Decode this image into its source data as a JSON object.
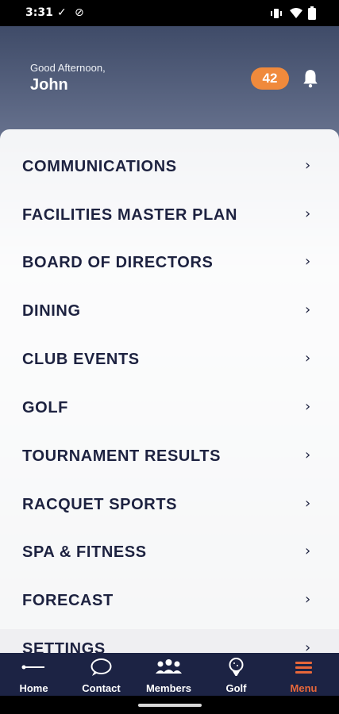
{
  "status_bar": {
    "time": "3:31",
    "left_icons": [
      "check-icon",
      "no-disturb-icon"
    ],
    "right_icons": [
      "vibrate-icon",
      "wifi-icon",
      "battery-icon"
    ]
  },
  "header": {
    "greeting": "Good Afternoon,",
    "name": "John",
    "notification_count": "42"
  },
  "menu": {
    "items": [
      {
        "label": "COMMUNICATIONS"
      },
      {
        "label": "FACILITIES MASTER PLAN"
      },
      {
        "label": "BOARD OF DIRECTORS"
      },
      {
        "label": "DINING"
      },
      {
        "label": "CLUB EVENTS"
      },
      {
        "label": "GOLF"
      },
      {
        "label": "TOURNAMENT RESULTS"
      },
      {
        "label": "RACQUET SPORTS"
      },
      {
        "label": "SPA & FITNESS"
      },
      {
        "label": "FORECAST"
      },
      {
        "label": "SETTINGS"
      }
    ],
    "chevron": "›"
  },
  "bottom_nav": {
    "items": [
      {
        "label": "Home",
        "icon": "home-line-icon"
      },
      {
        "label": "Contact",
        "icon": "chat-bubble-icon"
      },
      {
        "label": "Members",
        "icon": "members-icon"
      },
      {
        "label": "Golf",
        "icon": "golf-ball-tee-icon"
      },
      {
        "label": "Menu",
        "icon": "hamburger-menu-icon"
      }
    ],
    "active": "Menu"
  },
  "colors": {
    "accent": "#f08a3c",
    "nav_background": "#1c2344",
    "active_nav": "#e8673a",
    "menu_text": "#1d2240"
  }
}
